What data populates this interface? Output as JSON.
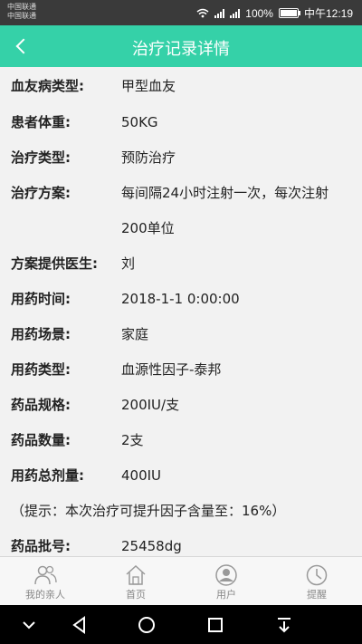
{
  "status_bar": {
    "carrier1": "中国联通",
    "carrier2": "中国联通",
    "battery": "100%",
    "time": "中午12:19"
  },
  "header": {
    "title": "治疗记录详情"
  },
  "details": [
    {
      "label": "血友病类型:",
      "value": "甲型血友"
    },
    {
      "label": "患者体重:",
      "value": "50KG"
    },
    {
      "label": "治疗类型:",
      "value": "预防治疗"
    },
    {
      "label": "治疗方案:",
      "value": "每间隔24小时注射一次，每次注射200单位"
    },
    {
      "label": "方案提供医生:",
      "value": "刘"
    },
    {
      "label": "用药时间:",
      "value": "2018-1-1 0:00:00"
    },
    {
      "label": "用药场景:",
      "value": "家庭"
    },
    {
      "label": "用药类型:",
      "value": "血源性因子-泰邦"
    },
    {
      "label": "药品规格:",
      "value": "200IU/支"
    },
    {
      "label": "药品数量:",
      "value": "2支"
    },
    {
      "label": "用药总剂量:",
      "value": "400IU"
    },
    {
      "label": "药品批号:",
      "value": "25458dg"
    }
  ],
  "hint": "（提示：本次治疗可提升因子含量至：16%）",
  "tabs": [
    {
      "label": "我的亲人",
      "icon": "relatives-icon"
    },
    {
      "label": "首页",
      "icon": "home-icon"
    },
    {
      "label": "用户",
      "icon": "user-icon"
    },
    {
      "label": "提醒",
      "icon": "clock-icon"
    }
  ],
  "colors": {
    "accent": "#35d1a8",
    "background": "#f2f2f2"
  }
}
